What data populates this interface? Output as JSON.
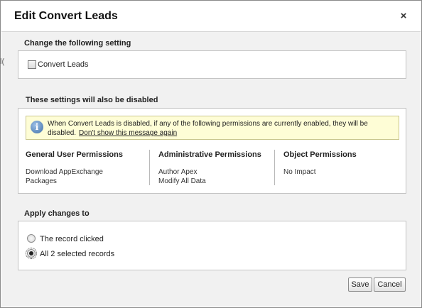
{
  "dialog": {
    "title": "Edit Convert Leads",
    "close_glyph": "×"
  },
  "section1": {
    "title": "Change the following setting",
    "checkbox_label": "Convert Leads",
    "checkbox_checked": false
  },
  "section2": {
    "title": "These settings will also be disabled",
    "info_icon": "info-icon",
    "info_text": "When Convert Leads is disabled, if any of the following permissions are currently enabled, they will be disabled.",
    "info_link": "Don't show this message again",
    "columns": [
      {
        "header": "General User Permissions",
        "items": [
          "Download AppExchange",
          "Packages"
        ]
      },
      {
        "header": "Administrative Permissions",
        "items": [
          "Author Apex",
          "Modify All Data"
        ]
      },
      {
        "header": "Object Permissions",
        "items": [
          "No Impact"
        ]
      }
    ]
  },
  "section3": {
    "title": "Apply changes to",
    "options": [
      {
        "label": "The record clicked",
        "checked": false
      },
      {
        "label": "All 2 selected records",
        "checked": true
      }
    ]
  },
  "footer": {
    "save_label": "Save",
    "cancel_label": "Cancel"
  },
  "background_fragment": "l("
}
